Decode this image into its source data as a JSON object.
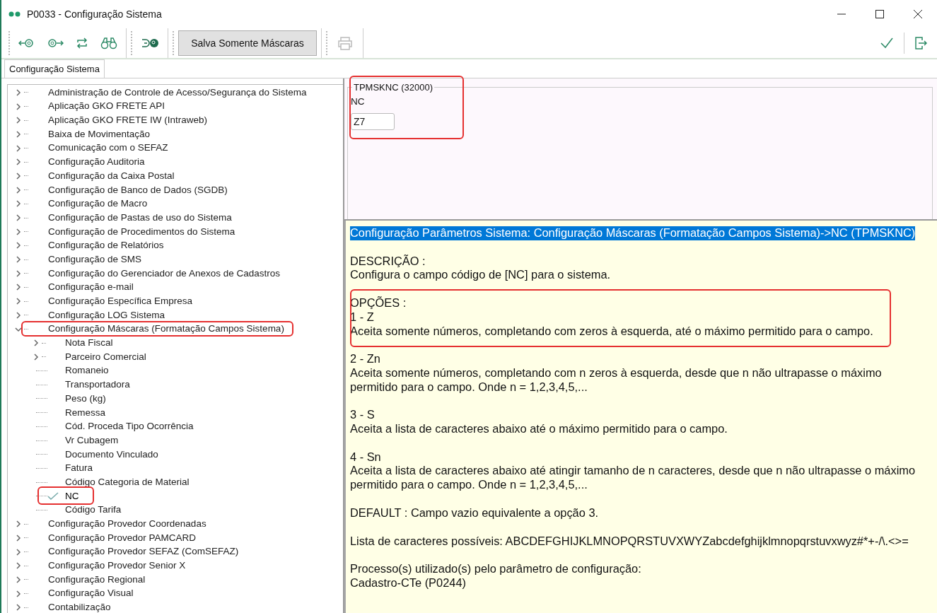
{
  "window": {
    "title": "P0033 - Configuração Sistema"
  },
  "toolbar": {
    "save_masks_button": "Salva Somente Máscaras",
    "print_button": {
      "disabled": true
    }
  },
  "tabs": [
    {
      "label": "Configuração Sistema",
      "selected": true
    }
  ],
  "tree": {
    "items": [
      {
        "label": "Administração de Controle de Acesso/Segurança do Sistema",
        "expanded": false,
        "selected": false
      },
      {
        "label": "Aplicação GKO FRETE API",
        "expanded": false,
        "selected": false
      },
      {
        "label": "Aplicação GKO FRETE IW (Intraweb)",
        "expanded": false,
        "selected": false
      },
      {
        "label": "Baixa de Movimentação",
        "expanded": false,
        "selected": false
      },
      {
        "label": "Comunicação com o SEFAZ",
        "expanded": false,
        "selected": false
      },
      {
        "label": "Configuração Auditoria",
        "expanded": false,
        "selected": false
      },
      {
        "label": "Configuração da Caixa Postal",
        "expanded": false,
        "selected": false
      },
      {
        "label": "Configuração de Banco de Dados (SGDB)",
        "expanded": false,
        "selected": false
      },
      {
        "label": "Configuração de Macro",
        "expanded": false,
        "selected": false
      },
      {
        "label": "Configuração de Pastas de uso do Sistema",
        "expanded": false,
        "selected": false
      },
      {
        "label": "Configuração de Procedimentos do Sistema",
        "expanded": false,
        "selected": false
      },
      {
        "label": "Configuração de Relatórios",
        "expanded": false,
        "selected": false
      },
      {
        "label": "Configuração de SMS",
        "expanded": false,
        "selected": false
      },
      {
        "label": "Configuração do Gerenciador de Anexos de Cadastros",
        "expanded": false,
        "selected": false
      },
      {
        "label": "Configuração e-mail",
        "expanded": false,
        "selected": false
      },
      {
        "label": "Configuração Específica Empresa",
        "expanded": false,
        "selected": false
      },
      {
        "label": "Configuração LOG Sistema",
        "expanded": false,
        "selected": false
      },
      {
        "label": "Configuração Máscaras (Formatação Campos Sistema)",
        "expanded": true,
        "selected": false,
        "children": [
          {
            "label": "Nota Fiscal",
            "expanded": false,
            "selected": false
          },
          {
            "label": "Parceiro Comercial",
            "expanded": false,
            "selected": false
          },
          {
            "label": "Romaneio",
            "selected": false
          },
          {
            "label": "Transportadora",
            "selected": false
          },
          {
            "label": "Peso (kg)",
            "selected": false
          },
          {
            "label": "Remessa",
            "selected": false
          },
          {
            "label": "Cód. Proceda Tipo Ocorrência",
            "selected": false
          },
          {
            "label": "Vr Cubagem",
            "selected": false
          },
          {
            "label": "Documento Vinculado",
            "selected": false
          },
          {
            "label": "Fatura",
            "selected": false
          },
          {
            "label": "Código Categoria de Material",
            "selected": false
          },
          {
            "label": "NC",
            "selected": true
          },
          {
            "label": "Código Tarifa",
            "selected": false
          }
        ]
      },
      {
        "label": "Configuração Provedor Coordenadas",
        "expanded": false,
        "selected": false
      },
      {
        "label": "Configuração Provedor PAMCARD",
        "expanded": false,
        "selected": false
      },
      {
        "label": "Configuração Provedor SEFAZ (ComSEFAZ)",
        "expanded": false,
        "selected": false
      },
      {
        "label": "Configuração Provedor Senior X",
        "expanded": false,
        "selected": false
      },
      {
        "label": "Configuração Regional",
        "expanded": false,
        "selected": false
      },
      {
        "label": "Configuração Visual",
        "expanded": false,
        "selected": false
      },
      {
        "label": "Contabilização",
        "expanded": false,
        "selected": false
      }
    ]
  },
  "parameter": {
    "legend": "TPMSKNC (32000)",
    "label": "NC",
    "value": "Z7"
  },
  "help": {
    "heading": "Configuração Parâmetros Sistema: Configuração Máscaras (Formatação Campos Sistema)->NC (TPMSKNC)",
    "paragraphs": [
      [
        "DESCRIÇÃO :",
        "Configura o campo código de [NC] para o sistema."
      ],
      [
        "OPÇÕES :",
        "1 - Z",
        "Aceita somente números, completando com zeros à esquerda, até o máximo permitido para o campo."
      ],
      [
        "2 - Zn",
        "Aceita somente números, completando com n zeros à esquerda, desde que n não ultrapasse o máximo permitido para o campo. Onde n = 1,2,3,4,5,..."
      ],
      [
        "3 - S",
        "Aceita a lista de caracteres abaixo até o máximo permitido para o campo."
      ],
      [
        "4 - Sn",
        "Aceita a lista de caracteres abaixo até atingir tamanho de n caracteres, desde que n não ultrapasse o máximo permitido para o campo. Onde n = 1,2,3,4,5,..."
      ],
      [
        "DEFAULT : Campo vazio equivalente a opção 3."
      ],
      [
        "Lista de caracteres possíveis: ABCDEFGHIJKLMNOPQRSTUVXWYZabcdefghijklmnopqrstuvxwyz#*+-/\\.<>="
      ],
      [
        "Processo(s) utilizado(s) pelo parâmetro de configuração:",
        "Cadastro-CTe (P0244)"
      ]
    ]
  }
}
